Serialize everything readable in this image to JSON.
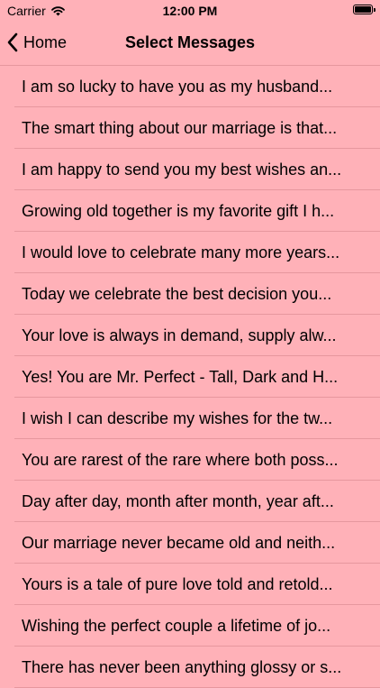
{
  "status_bar": {
    "carrier": "Carrier",
    "time": "12:00 PM",
    "battery_level": 1.0
  },
  "nav": {
    "back_label": "Home",
    "title": "Select Messages"
  },
  "messages": [
    "I am so lucky to have you as my husband...",
    "The smart thing about our marriage is that...",
    "I am happy to send you my best wishes an...",
    "Growing old together is my favorite gift I h...",
    "I would love to celebrate many more years...",
    "Today we celebrate the best decision you...",
    "Your love is always in demand, supply alw...",
    "Yes! You are Mr. Perfect - Tall, Dark and H...",
    "I wish I can describe my wishes for the tw...",
    "You are rarest of the rare where both poss...",
    "Day after day, month after month, year aft...",
    "Our marriage never became old and neith...",
    "Yours is a tale of pure love told and retold...",
    "Wishing the perfect couple a lifetime of jo...",
    "There has never been anything glossy or s..."
  ],
  "colors": {
    "background": "#ffb1b8",
    "separator": "#e6979e",
    "text": "#000000"
  }
}
